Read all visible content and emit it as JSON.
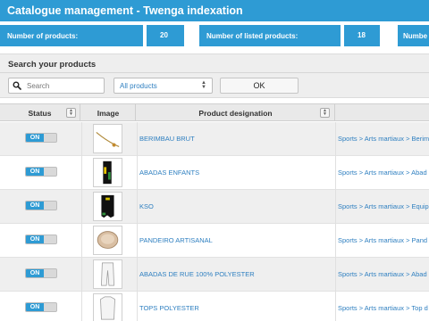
{
  "header": {
    "title": "Catalogue management - Twenga indexation"
  },
  "stats": {
    "products_label": "Number of products:",
    "products_value": "20",
    "listed_label": "Number of listed products:",
    "listed_value": "18",
    "third_label_partial": "Numbe"
  },
  "search": {
    "title": "Search your products",
    "placeholder": "Search",
    "select_value": "All products",
    "ok_label": "OK",
    "icon": "search-icon"
  },
  "table": {
    "columns": [
      "Status",
      "Image",
      "Product designation"
    ],
    "toggle_label": "ON",
    "rows": [
      {
        "name": "BERIMBAU BRUT",
        "category": "Sports > Arts martiaux > Berim",
        "image": "berimbau"
      },
      {
        "name": "ABADAS ENFANTS",
        "category": "Sports > Arts martiaux > Abad",
        "image": "abadas-kids"
      },
      {
        "name": "KSO",
        "category": "Sports > Arts martiaux > Equip",
        "image": "kso"
      },
      {
        "name": "PANDEIRO ARTISANAL",
        "category": "Sports > Arts martiaux > Pand",
        "image": "pandeiro"
      },
      {
        "name": "ABADAS DE RUE 100% POLYESTER",
        "category": "Sports > Arts martiaux > Abad",
        "image": "abadas-street"
      },
      {
        "name": "TOPS POLYESTER",
        "category": "Sports > Arts martiaux > Top d",
        "image": "tops"
      }
    ]
  },
  "colors": {
    "accent": "#2e9bd4",
    "link": "#2e7fc0",
    "panel": "#eeeeee"
  }
}
